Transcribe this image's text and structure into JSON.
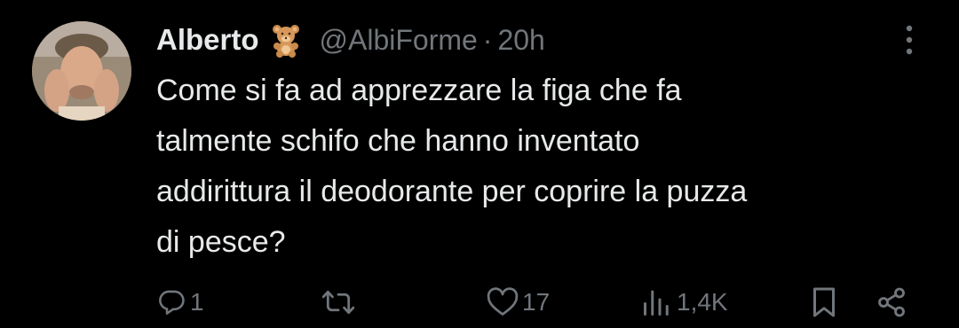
{
  "tweet": {
    "author": {
      "display_name": "Alberto",
      "emoji": "teddy-bear",
      "handle": "@AlbiForme",
      "separator": "·",
      "time": "20h"
    },
    "text": "Come si fa ad apprezzare la figa che fa\ntalmente schifo che hanno inventato\naddirittura il deodorante per coprire la puzza\ndi pesce?",
    "actions": {
      "replies": "1",
      "retweets": "",
      "likes": "17",
      "views": "1,4K"
    }
  },
  "colors": {
    "background": "#000000",
    "primary_text": "#e7e9ea",
    "secondary_text": "#71767b"
  }
}
